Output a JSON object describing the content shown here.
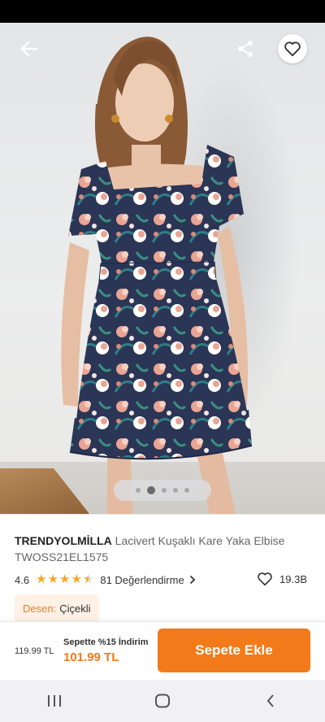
{
  "product": {
    "brand": "TRENDYOLMİLLA",
    "name": "Lacivert Kuşaklı  Kare Yaka Elbise",
    "code": "TWOSS21EL1575",
    "rating": "4.6",
    "rating_value": 4.6,
    "reviews_label": "81 Değerlendirme",
    "likes": "19.3B"
  },
  "gallery": {
    "image_count": 5,
    "active_index": 1
  },
  "attribute": {
    "key": "Desen:",
    "value": "Çiçekli"
  },
  "buybar": {
    "old_price": "119.99 TL",
    "discount_label": "Sepette %15 İndirim",
    "new_price": "101.99 TL",
    "add_to_cart_label": "Sepete Ekle"
  },
  "colors": {
    "accent": "#f27a1a",
    "star": "#f5a623",
    "dress_navy": "#2b3556",
    "flower_pink": "#e9a493"
  },
  "icons": {
    "back": "arrow-left-icon",
    "share": "share-icon",
    "favorite": "heart-icon",
    "like": "heart-outline-icon",
    "chevron": "chevron-right-icon",
    "nav_recent": "recent-apps-icon",
    "nav_home": "home-icon",
    "nav_back": "nav-back-icon"
  }
}
